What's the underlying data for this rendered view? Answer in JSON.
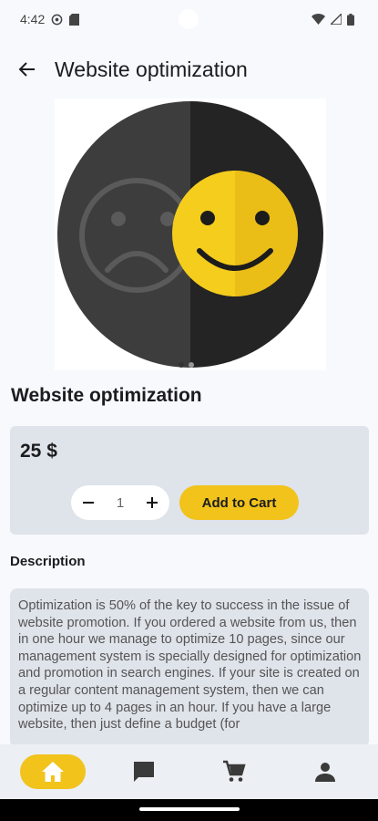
{
  "status_bar": {
    "time": "4:42"
  },
  "app_bar": {
    "title": "Website optimization",
    "back_icon": "arrow-back-icon"
  },
  "product": {
    "title": "Website optimization",
    "price": "25 $",
    "quantity": "1",
    "add_to_cart_label": "Add to Cart",
    "image_page_count": 2,
    "image_active_page": 1
  },
  "description": {
    "heading": "Description",
    "text": "Optimization is 50% of the key to success in the issue of website promotion. If you ordered a website from us, then in one hour we manage to optimize 10 pages, since our management system is specially designed for optimization and promotion in search engines. If your site is created on a regular content management system, then we can optimize up to 4 pages in an hour. If you have a large website, then just define a budget (for"
  },
  "nav": {
    "items": [
      {
        "name": "home",
        "icon": "home-icon",
        "active": true
      },
      {
        "name": "messages",
        "icon": "chat-icon",
        "active": false
      },
      {
        "name": "cart",
        "icon": "cart-icon",
        "active": false
      },
      {
        "name": "profile",
        "icon": "person-icon",
        "active": false
      }
    ]
  },
  "colors": {
    "accent": "#f1c31b",
    "card": "#dfe3ea",
    "background": "#f8f9fc"
  }
}
